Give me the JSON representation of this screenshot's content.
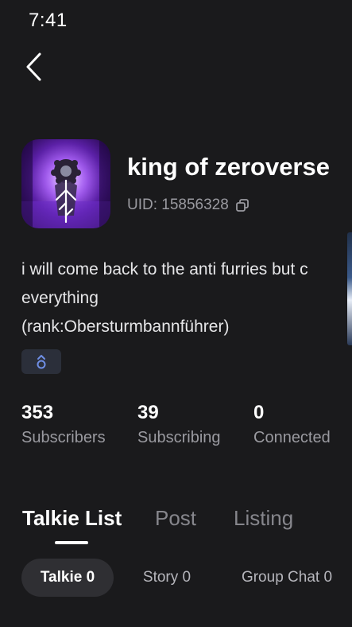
{
  "status_bar": {
    "time": "7:41"
  },
  "nav": {
    "back_icon": "chevron-left-icon"
  },
  "profile": {
    "name": "king of zeroverse",
    "uid": "UID: 15856328",
    "copy_icon": "copy-icon",
    "bio_lines": [
      "i will come back to the anti furries but c",
      "everything",
      "(rank:Obersturmbannführer)"
    ],
    "badge_icon": "gender-badge-icon",
    "badge_color": "#6f8fe6"
  },
  "stats": [
    {
      "value": "353",
      "label": "Subscribers"
    },
    {
      "value": "39",
      "label": "Subscribing"
    },
    {
      "value": "0",
      "label": "Connected"
    }
  ],
  "tabs": [
    {
      "label": "Talkie List",
      "active": true
    },
    {
      "label": "Post",
      "active": false
    },
    {
      "label": "Listing",
      "active": false
    }
  ],
  "subtabs": [
    {
      "label": "Talkie 0",
      "active": true
    },
    {
      "label": "Story 0",
      "active": false
    },
    {
      "label": "Group Chat 0",
      "active": false
    }
  ]
}
